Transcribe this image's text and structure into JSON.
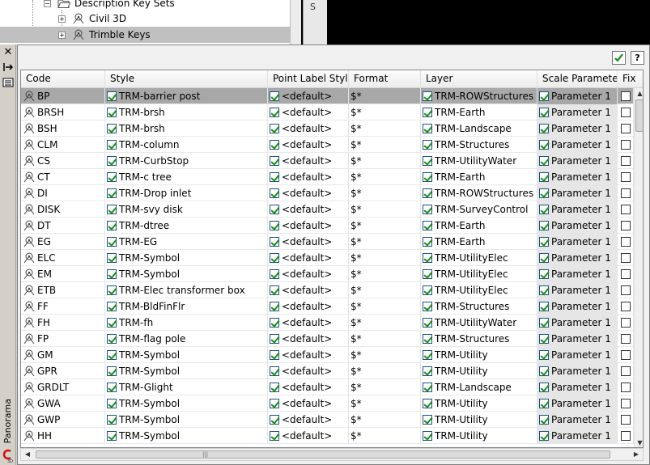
{
  "tree": {
    "parent_label": "Description Key Sets",
    "items": [
      {
        "label": "Civil 3D",
        "selected": false
      },
      {
        "label": "Trimble Keys",
        "selected": true
      }
    ]
  },
  "side_tab": {
    "label": "S"
  },
  "left_strip": {
    "close_glyph": "✕",
    "panorama_label": "Panorama"
  },
  "toolbar": {
    "apply_tooltip": "Apply",
    "help_label": "?"
  },
  "columns": [
    "Code",
    "Style",
    "Point Label Style",
    "Format",
    "Layer",
    "Scale Parameter",
    "Fix"
  ],
  "rows": [
    {
      "code": "BP",
      "style": "TRM-barrier post",
      "label_style": "<default>",
      "format": "$*",
      "layer": "TRM-ROWStructures",
      "scale": "Parameter 1",
      "selected": true
    },
    {
      "code": "BRSH",
      "style": "TRM-brsh",
      "label_style": "<default>",
      "format": "$*",
      "layer": "TRM-Earth",
      "scale": "Parameter 1"
    },
    {
      "code": "BSH",
      "style": "TRM-brsh",
      "label_style": "<default>",
      "format": "$*",
      "layer": "TRM-Landscape",
      "scale": "Parameter 1"
    },
    {
      "code": "CLM",
      "style": "TRM-column",
      "label_style": "<default>",
      "format": "$*",
      "layer": "TRM-Structures",
      "scale": "Parameter 1"
    },
    {
      "code": "CS",
      "style": "TRM-CurbStop",
      "label_style": "<default>",
      "format": "$*",
      "layer": "TRM-UtilityWater",
      "scale": "Parameter 1"
    },
    {
      "code": "CT",
      "style": "TRM-c tree",
      "label_style": "<default>",
      "format": "$*",
      "layer": "TRM-Earth",
      "scale": "Parameter 1"
    },
    {
      "code": "DI",
      "style": "TRM-Drop inlet",
      "label_style": "<default>",
      "format": "$*",
      "layer": "TRM-ROWStructures",
      "scale": "Parameter 1"
    },
    {
      "code": "DISK",
      "style": "TRM-svy disk",
      "label_style": "<default>",
      "format": "$*",
      "layer": "TRM-SurveyControl",
      "scale": "Parameter 1"
    },
    {
      "code": "DT",
      "style": "TRM-dtree",
      "label_style": "<default>",
      "format": "$*",
      "layer": "TRM-Earth",
      "scale": "Parameter 1"
    },
    {
      "code": "EG",
      "style": "TRM-EG",
      "label_style": "<default>",
      "format": "$*",
      "layer": "TRM-Earth",
      "scale": "Parameter 1"
    },
    {
      "code": "ELC",
      "style": "TRM-Symbol",
      "label_style": "<default>",
      "format": "$*",
      "layer": "TRM-UtilityElec",
      "scale": "Parameter 1"
    },
    {
      "code": "EM",
      "style": "TRM-Symbol",
      "label_style": "<default>",
      "format": "$*",
      "layer": "TRM-UtilityElec",
      "scale": "Parameter 1"
    },
    {
      "code": "ETB",
      "style": "TRM-Elec transformer box",
      "label_style": "<default>",
      "format": "$*",
      "layer": "TRM-UtilityElec",
      "scale": "Parameter 1"
    },
    {
      "code": "FF",
      "style": "TRM-BldFinFlr",
      "label_style": "<default>",
      "format": "$*",
      "layer": "TRM-Structures",
      "scale": "Parameter 1"
    },
    {
      "code": "FH",
      "style": "TRM-fh",
      "label_style": "<default>",
      "format": "$*",
      "layer": "TRM-UtilityWater",
      "scale": "Parameter 1"
    },
    {
      "code": "FP",
      "style": "TRM-flag pole",
      "label_style": "<default>",
      "format": "$*",
      "layer": "TRM-Structures",
      "scale": "Parameter 1"
    },
    {
      "code": "GM",
      "style": "TRM-Symbol",
      "label_style": "<default>",
      "format": "$*",
      "layer": "TRM-Utility",
      "scale": "Parameter 1"
    },
    {
      "code": "GPR",
      "style": "TRM-Symbol",
      "label_style": "<default>",
      "format": "$*",
      "layer": "TRM-Utility",
      "scale": "Parameter 1"
    },
    {
      "code": "GRDLT",
      "style": "TRM-Glight",
      "label_style": "<default>",
      "format": "$*",
      "layer": "TRM-Landscape",
      "scale": "Parameter 1"
    },
    {
      "code": "GWA",
      "style": "TRM-Symbol",
      "label_style": "<default>",
      "format": "$*",
      "layer": "TRM-Utility",
      "scale": "Parameter 1"
    },
    {
      "code": "GWP",
      "style": "TRM-Symbol",
      "label_style": "<default>",
      "format": "$*",
      "layer": "TRM-Utility",
      "scale": "Parameter 1"
    },
    {
      "code": "HH",
      "style": "TRM-Symbol",
      "label_style": "<default>",
      "format": "$*",
      "layer": "TRM-Utility",
      "scale": "Parameter 1"
    }
  ],
  "colors": {
    "selected_row": "#a8a8a8",
    "check_green": "#1a8a1a",
    "check_border": "#1c5180",
    "panel_bg": "#f0f0f0"
  },
  "icons": {
    "code_icon": "description-key-icon",
    "tree_node_icon": "description-key-set-icon",
    "folder_icon": "folder-open-icon"
  }
}
